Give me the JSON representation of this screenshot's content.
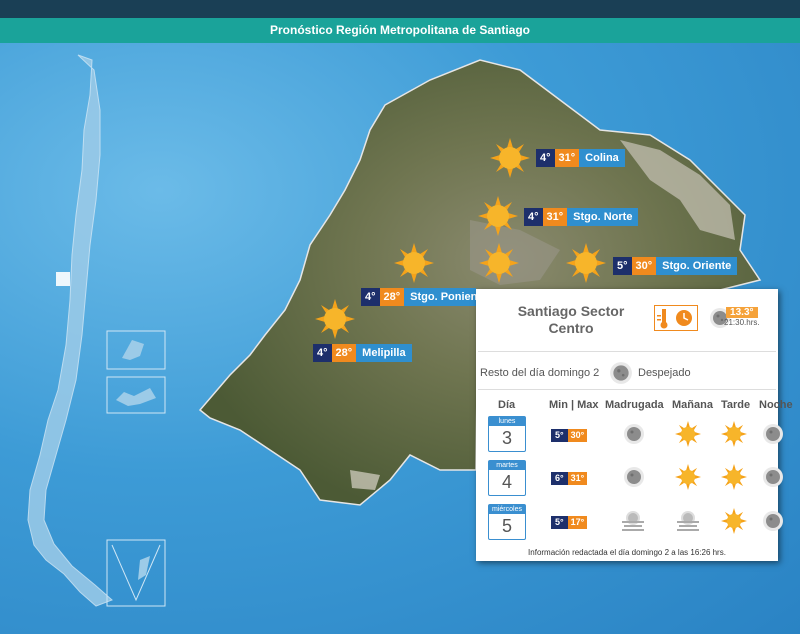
{
  "header": {
    "title": "Pronóstico Región Metropolitana de Santiago"
  },
  "locations": [
    {
      "name": "Colina",
      "min": "4°",
      "max": "31°"
    },
    {
      "name": "Stgo. Norte",
      "min": "4°",
      "max": "31°"
    },
    {
      "name": "Stgo. Oriente",
      "min": "5°",
      "max": "30°"
    },
    {
      "name": "Stgo. Poniente",
      "min": "4°",
      "max": "28°"
    },
    {
      "name": "Melipilla",
      "min": "4°",
      "max": "28°"
    }
  ],
  "panel": {
    "title_line1": "Santiago Sector",
    "title_line2": "Centro",
    "current_temp": "13.3°",
    "current_time": "21:30.hrs.",
    "resto_label": "Resto del día domingo 2",
    "resto_condition": "Despejado",
    "headers": {
      "dia": "Día",
      "minmax": "Min | Max",
      "madrugada": "Madrugada",
      "manana": "Mañana",
      "tarde": "Tarde",
      "noche": "Noche"
    },
    "days": [
      {
        "name": "lunes",
        "num": "3",
        "min": "5°",
        "max": "30°",
        "icons": [
          "moon-icon",
          "sun-icon",
          "sun-icon",
          "moon-icon"
        ]
      },
      {
        "name": "martes",
        "num": "4",
        "min": "6°",
        "max": "31°",
        "icons": [
          "moon-icon",
          "sun-icon",
          "sun-icon",
          "moon-icon"
        ]
      },
      {
        "name": "miércoles",
        "num": "5",
        "min": "5°",
        "max": "17°",
        "icons": [
          "fog-icon",
          "fog-icon",
          "sun-icon",
          "moon-icon"
        ]
      }
    ],
    "footer": "Información redactada el día domingo 2 a las 16:26 hrs."
  },
  "colors": {
    "title_bar": "#1aa39a",
    "min_temp": "#1d2f6b",
    "max_temp": "#f08a1e",
    "location": "#2f8fcf",
    "ocean": "#3d9bd6"
  }
}
